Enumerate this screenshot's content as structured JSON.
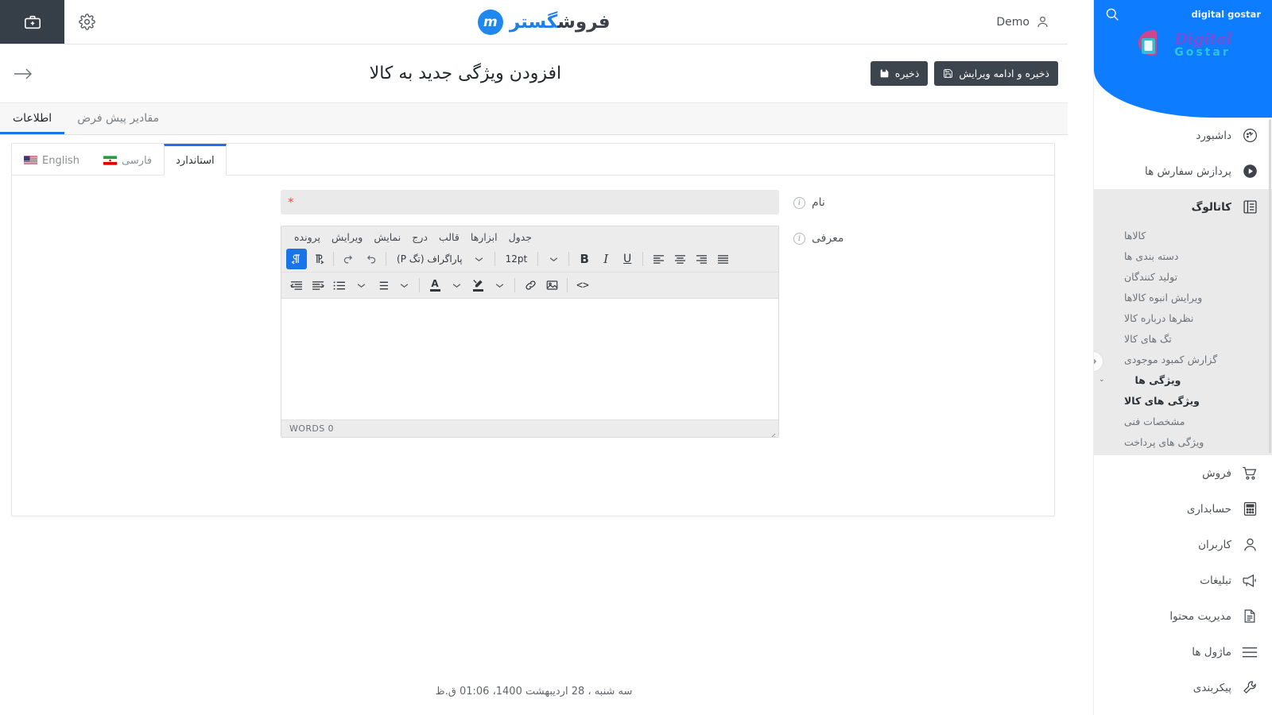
{
  "topbar": {
    "briefcase_icon": "medical-kit-icon",
    "gear_icon": "gear-icon",
    "logo_part1": "فروش",
    "logo_part2": "گستر",
    "logo_mark": "m",
    "user_name": "Demo",
    "user_icon": "user-icon"
  },
  "titlebar": {
    "back_arrow": "←",
    "page_title": "افزودن ویژگی جدید به کالا",
    "save_label": "ذخیره",
    "save_continue_label": "ذخیره و ادامه ویرایش"
  },
  "tabs": [
    {
      "label": "اطلاعات",
      "active": true
    },
    {
      "label": "مقادیر پیش فرض",
      "active": false
    }
  ],
  "lang_tabs": [
    {
      "label": "استاندارد",
      "flag": "none",
      "active": true
    },
    {
      "label": "فارسی",
      "flag": "ir",
      "active": false
    },
    {
      "label": "English",
      "flag": "us",
      "active": false
    }
  ],
  "form": {
    "name": {
      "label": "نام",
      "value": "",
      "placeholder": "",
      "required_mark": "*"
    },
    "intro": {
      "label": "معرفی"
    }
  },
  "editor": {
    "menu": [
      "پرونده",
      "ویرایش",
      "نمایش",
      "درج",
      "قالب",
      "ابزارها",
      "جدول"
    ],
    "toolbar_row1": {
      "rtl_button": "¶",
      "ltr_button": "¶",
      "redo": "↷",
      "undo": "↶",
      "block_format": "پاراگراف (تگ P)",
      "font_size": "12pt",
      "more_caret": "⌄",
      "bold": "B",
      "italic": "I",
      "underline": "U",
      "align_left": "align-left-icon",
      "align_center": "align-center-icon",
      "align_right": "align-right-icon",
      "align_justify": "align-justify-icon"
    },
    "toolbar_row2": {
      "outdent": "outdent-icon",
      "indent": "indent-icon",
      "bullet_list": "bullet-list-icon",
      "numbered_list": "numbered-list-icon",
      "text_color": "A",
      "highlight_color": "highlight-icon",
      "link": "link-icon",
      "image": "image-icon",
      "source_code": "<>"
    },
    "content": "",
    "status_words": "WORDS 0"
  },
  "footer": {
    "date": "سه شنبه ، 28 اردیبهشت 1400، 01:06 ق.ظ"
  },
  "sidebar": {
    "shop_name": "digital gostar",
    "search_icon": "search-icon",
    "logo_title": "Digital",
    "logo_subtitle": "Gostar",
    "collapse_icon": "chevron-right-icon",
    "items": [
      {
        "label": "داشبورد",
        "icon": "gauge-icon"
      },
      {
        "label": "پردازش سفارش ها",
        "icon": "play-icon"
      },
      {
        "label": "کاتالوگ",
        "icon": "catalog-icon",
        "active": true
      },
      {
        "label": "فروش",
        "icon": "cart-icon"
      },
      {
        "label": "حسابداری",
        "icon": "calculator-icon"
      },
      {
        "label": "کاربران",
        "icon": "user-icon"
      },
      {
        "label": "تبلیغات",
        "icon": "megaphone-icon"
      },
      {
        "label": "مدیریت محتوا",
        "icon": "document-icon"
      },
      {
        "label": "ماژول ها",
        "icon": "menu-lines-icon"
      },
      {
        "label": "پیکربندی",
        "icon": "wrench-icon"
      }
    ],
    "catalog_sub": [
      {
        "label": "کالاها"
      },
      {
        "label": "دسته بندی ها"
      },
      {
        "label": "تولید کنندگان"
      },
      {
        "label": "ویرایش انبوه کالاها"
      },
      {
        "label": "نظرها درباره کالا"
      },
      {
        "label": "تگ های کالا"
      },
      {
        "label": "گزارش کمبود موجودی"
      },
      {
        "label": "ویژگی ها",
        "group": true,
        "chevron": "⌄"
      },
      {
        "label": "ویژگی های کالا",
        "selected": true
      },
      {
        "label": "مشخصات فنی"
      },
      {
        "label": "ویژگی های پرداخت"
      }
    ]
  },
  "colors": {
    "accent_blue": "#1a73e8",
    "sidebar_blue": "#0d7cff",
    "dark": "#3c444e",
    "required_red": "#f4483b"
  }
}
